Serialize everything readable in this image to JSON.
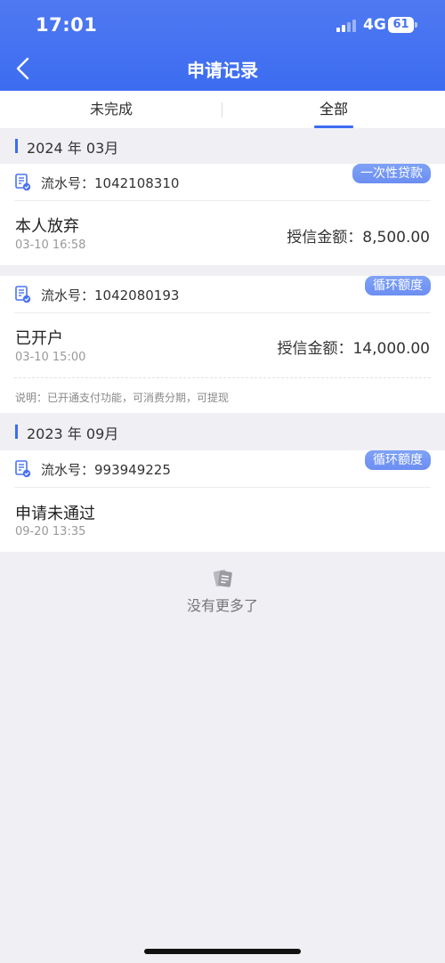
{
  "status_bar": {
    "time": "17:01",
    "network": "4G",
    "battery": "61"
  },
  "nav": {
    "title": "申请记录",
    "back_icon": "chevron-left-icon"
  },
  "tabs": [
    {
      "label": "未完成",
      "active": false
    },
    {
      "label": "全部",
      "active": true
    }
  ],
  "groups": [
    {
      "title": "2024 年 03月",
      "records": [
        {
          "serial": "流水号：1042108310",
          "tag": "一次性贷款",
          "status": "本人放弃",
          "datetime": "03-10 16:58",
          "amount": "授信金额：8,500.00",
          "note": ""
        },
        {
          "serial": "流水号：1042080193",
          "tag": "循环额度",
          "status": "已开户",
          "datetime": "03-10 15:00",
          "amount": "授信金额：14,000.00",
          "note": "说明：已开通支付功能，可消费分期，可提现"
        }
      ]
    },
    {
      "title": "2023 年 09月",
      "records": [
        {
          "serial": "流水号：993949225",
          "tag": "循环额度",
          "status": "申请未通过",
          "datetime": "09-20 13:35",
          "amount": "",
          "note": ""
        }
      ]
    }
  ],
  "empty": {
    "icon": "document-note-icon",
    "text": "没有更多了"
  },
  "colors": {
    "primary": "#3c6cf0",
    "tag": "#6b8ef2",
    "background": "#efeff4"
  }
}
